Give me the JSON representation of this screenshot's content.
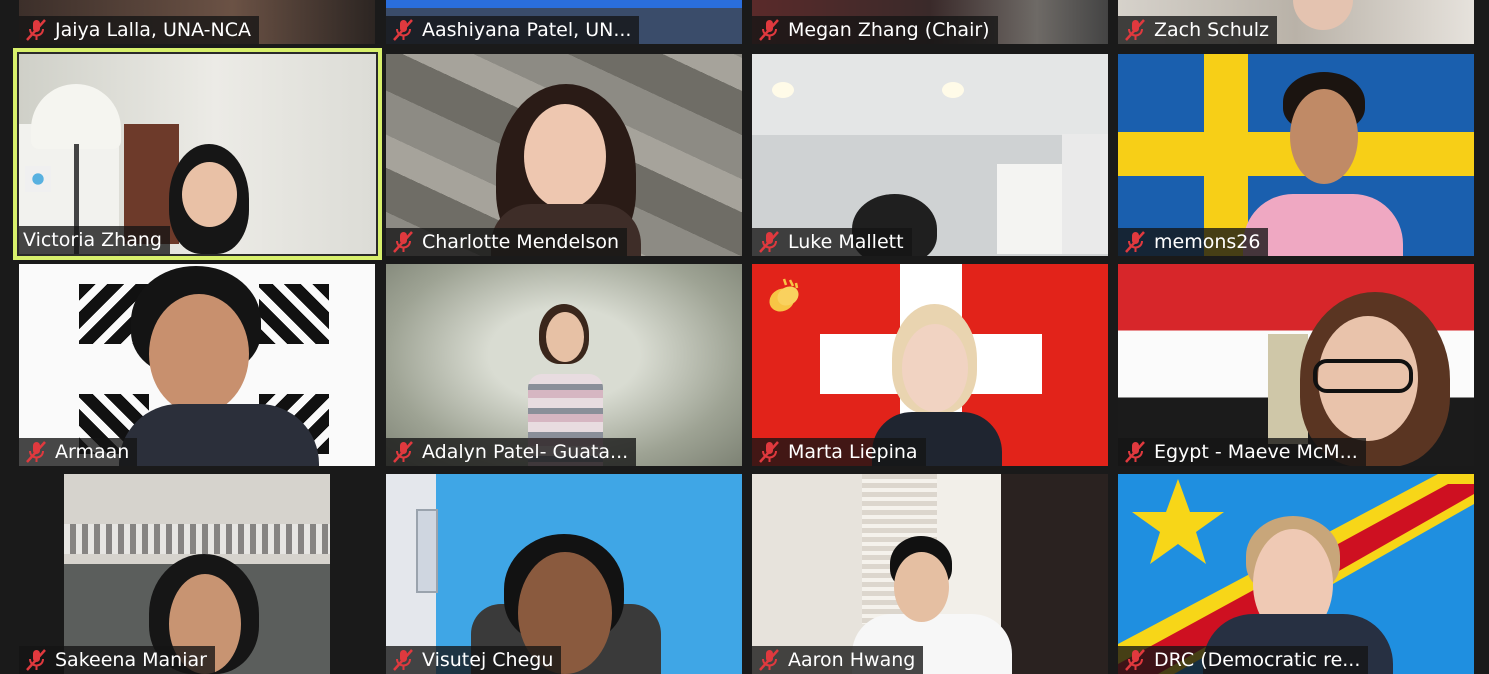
{
  "participants": [
    {
      "name": "Jaiya Lalla, UNA-NCA",
      "muted": true
    },
    {
      "name": "Aashiyana Patel, UN...",
      "muted": true
    },
    {
      "name": "Megan Zhang (Chair)",
      "muted": true
    },
    {
      "name": "Zach Schulz",
      "muted": true
    },
    {
      "name": "Victoria Zhang",
      "muted": false,
      "speaking": true
    },
    {
      "name": "Charlotte Mendelson",
      "muted": true
    },
    {
      "name": "Luke Mallett",
      "muted": true
    },
    {
      "name": "memons26",
      "muted": true
    },
    {
      "name": "Armaan",
      "muted": true
    },
    {
      "name": "Adalyn Patel- Guata...",
      "muted": true
    },
    {
      "name": "Marta Liepina",
      "muted": true,
      "reaction": "clapping-hands"
    },
    {
      "name": "Egypt - Maeve McM...",
      "muted": true
    },
    {
      "name": "Sakeena Maniar",
      "muted": true
    },
    {
      "name": "Visutej Chegu",
      "muted": true
    },
    {
      "name": "Aaron Hwang",
      "muted": true
    },
    {
      "name": "DRC (Democratic re...",
      "muted": true
    }
  ],
  "colors": {
    "speaker_highlight": "#d8f06c",
    "mute_icon": "#e0393e",
    "nametag_bg": "#141414"
  },
  "icons": {
    "mute": "microphone-muted-icon",
    "reaction": "clapping-hands-icon"
  }
}
